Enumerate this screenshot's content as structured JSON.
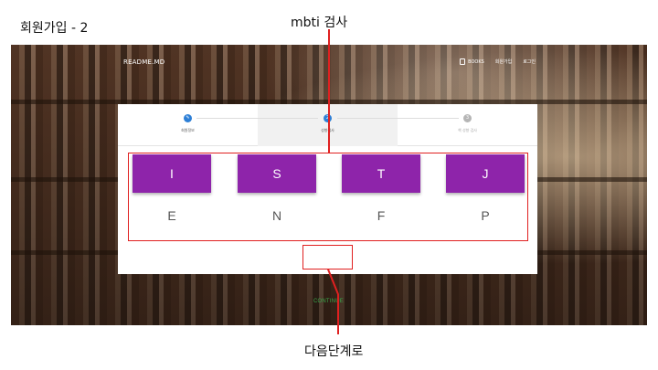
{
  "slide": {
    "title": "회원가입 - 2",
    "annotation_top": "mbti 검사",
    "annotation_bottom": "다음단계로"
  },
  "nav": {
    "brand": "README.MD",
    "links": [
      "BOOKS",
      "회원가입",
      "로그인"
    ]
  },
  "stepper": {
    "steps": [
      {
        "label": "회원정보",
        "icon": "pencil-icon"
      },
      {
        "label": "성향검사",
        "number": "2"
      },
      {
        "label": "책 성향 검사",
        "number": "3"
      }
    ],
    "active_index": 1
  },
  "mbti": {
    "pairs": [
      {
        "selected": "I",
        "alternative": "E"
      },
      {
        "selected": "S",
        "alternative": "N"
      },
      {
        "selected": "T",
        "alternative": "F"
      },
      {
        "selected": "J",
        "alternative": "P"
      }
    ]
  },
  "actions": {
    "continue_label": "CONTINUE"
  },
  "colors": {
    "accent_purple": "#8e24aa",
    "step_blue": "#2d7fd6",
    "continue_green": "#3aa64a",
    "annotation_red": "#e02020"
  }
}
